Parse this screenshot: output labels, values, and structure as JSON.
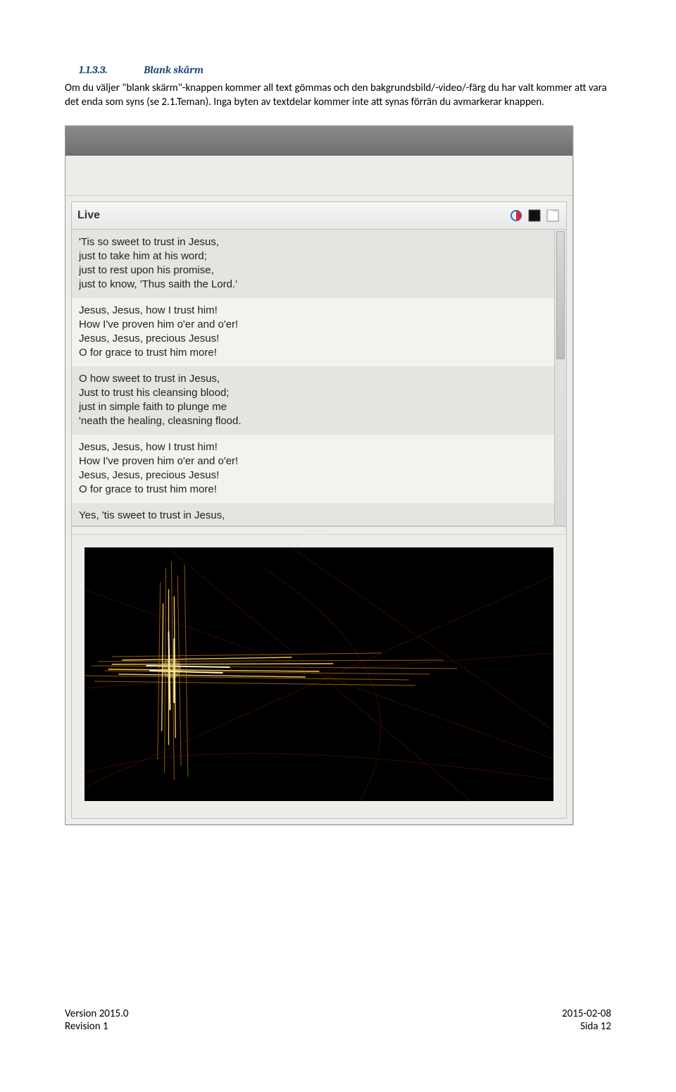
{
  "heading": {
    "number": "1.1.3.3.",
    "title": "Blank skärm"
  },
  "paragraph": "Om du väljer \"blank skärm\"-knappen kommer all text gömmas och den bakgrundsbild/-video/-färg du har valt kommer att vara det enda som syns (se 2.1.Teman). Inga byten av textdelar kommer inte att synas förrän du avmarkerar knappen.",
  "app": {
    "panel_title": "Live",
    "splitter_dots": "· · ·",
    "verses": [
      "'Tis so sweet to trust in Jesus,\njust to take him at his word;\njust to rest upon his promise,\njust to know, 'Thus saith the Lord.'",
      "Jesus, Jesus, how I trust him!\nHow I've proven him o'er and o'er!\nJesus, Jesus, precious Jesus!\nO for grace to trust him more!",
      "O how sweet to trust in Jesus,\nJust to trust his cleansing blood;\njust in simple faith to plunge me\n'neath the healing, cleasning flood.",
      "Jesus, Jesus, how I trust him!\nHow I've proven him o'er and o'er!\nJesus, Jesus, precious Jesus!\nO for grace to trust him more!",
      "Yes, 'tis sweet to trust in Jesus,"
    ],
    "icons": {
      "theme": "theme-icon",
      "blank": "blank-screen-icon",
      "desktop": "show-desktop-icon"
    }
  },
  "footer": {
    "left1": "Version 2015.0",
    "left2": "Revision 1",
    "right1": "2015-02-08",
    "right2": "Sida 12"
  }
}
